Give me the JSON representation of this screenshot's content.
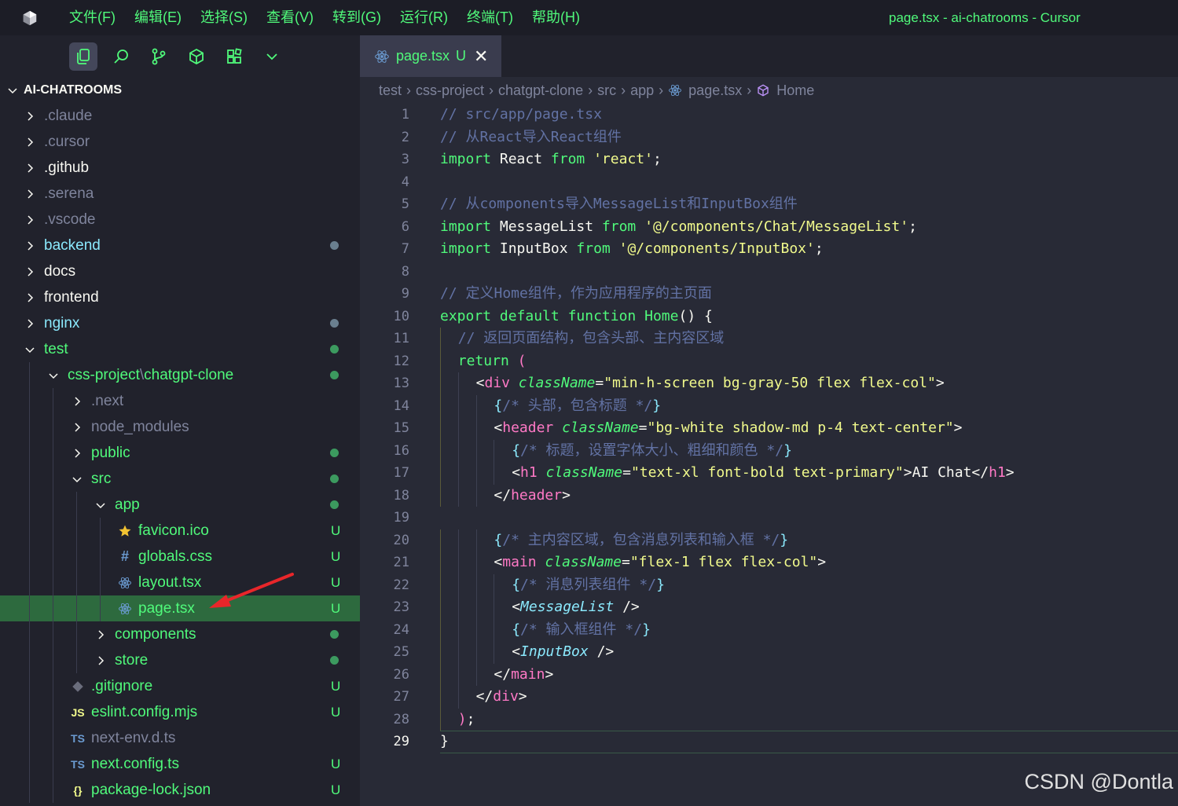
{
  "window": {
    "title": "page.tsx - ai-chatrooms - Cursor"
  },
  "menu": [
    "文件(F)",
    "编辑(E)",
    "选择(S)",
    "查看(V)",
    "转到(G)",
    "运行(R)",
    "终端(T)",
    "帮助(H)"
  ],
  "activity_icons": [
    "explorer-icon",
    "search-icon",
    "source-control-icon",
    "extensions-icon",
    "grid-icon",
    "chevron-down-icon"
  ],
  "tab": {
    "label": "page.tsx",
    "badge": "U",
    "close": "✕"
  },
  "breadcrumb": [
    "test",
    "css-project",
    "chatgpt-clone",
    "src",
    "app",
    "page.tsx",
    "Home"
  ],
  "explorer": {
    "title": "AI-CHATROOMS",
    "items": [
      {
        "label": ".claude",
        "depth": 0,
        "kind": "folder",
        "expanded": false,
        "style": "dim",
        "status": ""
      },
      {
        "label": ".cursor",
        "depth": 0,
        "kind": "folder",
        "expanded": false,
        "style": "dim",
        "status": ""
      },
      {
        "label": ".github",
        "depth": 0,
        "kind": "folder",
        "expanded": false,
        "style": "white",
        "status": ""
      },
      {
        "label": ".serena",
        "depth": 0,
        "kind": "folder",
        "expanded": false,
        "style": "dim",
        "status": ""
      },
      {
        "label": ".vscode",
        "depth": 0,
        "kind": "folder",
        "expanded": false,
        "style": "dim",
        "status": ""
      },
      {
        "label": "backend",
        "depth": 0,
        "kind": "folder",
        "expanded": false,
        "style": "cyan",
        "status": "dot-gray"
      },
      {
        "label": "docs",
        "depth": 0,
        "kind": "folder",
        "expanded": false,
        "style": "white",
        "status": ""
      },
      {
        "label": "frontend",
        "depth": 0,
        "kind": "folder",
        "expanded": false,
        "style": "white",
        "status": ""
      },
      {
        "label": "nginx",
        "depth": 0,
        "kind": "folder",
        "expanded": false,
        "style": "cyan",
        "status": "dot-gray"
      },
      {
        "label": "test",
        "depth": 0,
        "kind": "folder",
        "expanded": true,
        "style": "green",
        "status": "dot-green"
      },
      {
        "label": "css-project",
        "label2": "chatgpt-clone",
        "depth": 1,
        "kind": "folder",
        "expanded": true,
        "style": "green",
        "status": "dot-green"
      },
      {
        "label": ".next",
        "depth": 2,
        "kind": "folder",
        "expanded": false,
        "style": "dim",
        "status": ""
      },
      {
        "label": "node_modules",
        "depth": 2,
        "kind": "folder",
        "expanded": false,
        "style": "dim",
        "status": ""
      },
      {
        "label": "public",
        "depth": 2,
        "kind": "folder",
        "expanded": false,
        "style": "green",
        "status": "dot-green"
      },
      {
        "label": "src",
        "depth": 2,
        "kind": "folder",
        "expanded": true,
        "style": "green",
        "status": "dot-green"
      },
      {
        "label": "app",
        "depth": 3,
        "kind": "folder",
        "expanded": true,
        "style": "green",
        "status": "dot-green"
      },
      {
        "label": "favicon.ico",
        "depth": 4,
        "kind": "file",
        "icon": "star-icon",
        "style": "green",
        "status": "U"
      },
      {
        "label": "globals.css",
        "depth": 4,
        "kind": "file",
        "icon": "hash-icon",
        "style": "green",
        "status": "U"
      },
      {
        "label": "layout.tsx",
        "depth": 4,
        "kind": "file",
        "icon": "react-icon",
        "style": "green",
        "status": "U"
      },
      {
        "label": "page.tsx",
        "depth": 4,
        "kind": "file",
        "icon": "react-icon",
        "style": "green",
        "status": "U",
        "selected": true
      },
      {
        "label": "components",
        "depth": 3,
        "kind": "folder",
        "expanded": false,
        "style": "green",
        "status": "dot-green"
      },
      {
        "label": "store",
        "depth": 3,
        "kind": "folder",
        "expanded": false,
        "style": "green",
        "status": "dot-green"
      },
      {
        "label": ".gitignore",
        "depth": 2,
        "kind": "file",
        "icon": "git-icon",
        "style": "green",
        "status": "U"
      },
      {
        "label": "eslint.config.mjs",
        "depth": 2,
        "kind": "file",
        "icon": "js-icon",
        "icon_text": "JS",
        "style": "green",
        "status": "U"
      },
      {
        "label": "next-env.d.ts",
        "depth": 2,
        "kind": "file",
        "icon": "ts-icon",
        "icon_text": "TS",
        "style": "dim",
        "status": ""
      },
      {
        "label": "next.config.ts",
        "depth": 2,
        "kind": "file",
        "icon": "ts-icon",
        "icon_text": "TS",
        "style": "green",
        "status": "U"
      },
      {
        "label": "package-lock.json",
        "depth": 2,
        "kind": "file",
        "icon": "json-icon",
        "icon_text": "{}",
        "style": "green",
        "status": "U"
      }
    ]
  },
  "editor": {
    "current_line": 29,
    "lines": [
      {
        "n": "1",
        "indent": 0,
        "tokens": [
          [
            "c-com",
            "// src/app/page.tsx"
          ]
        ]
      },
      {
        "n": "2",
        "indent": 0,
        "tokens": [
          [
            "c-com",
            "// 从React导入React组件"
          ]
        ]
      },
      {
        "n": "3",
        "indent": 0,
        "tokens": [
          [
            "c-kw",
            "import"
          ],
          [
            "",
            " React "
          ],
          [
            "c-kw",
            "from"
          ],
          [
            "",
            " "
          ],
          [
            "c-str",
            "'react'"
          ],
          [
            "",
            ";"
          ]
        ]
      },
      {
        "n": "4",
        "indent": 0,
        "tokens": []
      },
      {
        "n": "5",
        "indent": 0,
        "tokens": [
          [
            "c-com",
            "// 从components导入MessageList和InputBox组件"
          ]
        ]
      },
      {
        "n": "6",
        "indent": 0,
        "tokens": [
          [
            "c-kw",
            "import"
          ],
          [
            "",
            " MessageList "
          ],
          [
            "c-kw",
            "from"
          ],
          [
            "",
            " "
          ],
          [
            "c-str",
            "'@/components/Chat/MessageList'"
          ],
          [
            "",
            ";"
          ]
        ]
      },
      {
        "n": "7",
        "indent": 0,
        "tokens": [
          [
            "c-kw",
            "import"
          ],
          [
            "",
            " InputBox "
          ],
          [
            "c-kw",
            "from"
          ],
          [
            "",
            " "
          ],
          [
            "c-str",
            "'@/components/InputBox'"
          ],
          [
            "",
            ";"
          ]
        ]
      },
      {
        "n": "8",
        "indent": 0,
        "tokens": []
      },
      {
        "n": "9",
        "indent": 0,
        "tokens": [
          [
            "c-com",
            "// 定义Home组件，作为应用程序的主页面"
          ]
        ]
      },
      {
        "n": "10",
        "indent": 0,
        "tokens": [
          [
            "c-kw",
            "export"
          ],
          [
            "",
            " "
          ],
          [
            "c-kw",
            "default"
          ],
          [
            "",
            " "
          ],
          [
            "c-kw",
            "function"
          ],
          [
            "",
            " "
          ],
          [
            "c-fn",
            "Home"
          ],
          [
            "",
            "() {"
          ]
        ]
      },
      {
        "n": "11",
        "indent": 1,
        "tokens": [
          [
            "c-com",
            "// 返回页面结构，包含头部、主内容区域"
          ]
        ]
      },
      {
        "n": "12",
        "indent": 1,
        "tokens": [
          [
            "c-kw",
            "return"
          ],
          [
            "",
            " "
          ],
          [
            "c-paren",
            "("
          ]
        ]
      },
      {
        "n": "13",
        "indent": 2,
        "tokens": [
          [
            "",
            "<"
          ],
          [
            "c-tag",
            "div"
          ],
          [
            "",
            " "
          ],
          [
            "c-attr",
            "className"
          ],
          [
            "",
            "="
          ],
          [
            "c-str",
            "\"min-h-screen bg-gray-50 flex flex-col\""
          ],
          [
            "",
            ">"
          ]
        ]
      },
      {
        "n": "14",
        "indent": 3,
        "tokens": [
          [
            "c-brace",
            "{"
          ],
          [
            "c-com",
            "/* 头部，包含标题 */"
          ],
          [
            "c-brace",
            "}"
          ]
        ]
      },
      {
        "n": "15",
        "indent": 3,
        "tokens": [
          [
            "",
            "<"
          ],
          [
            "c-tag",
            "header"
          ],
          [
            "",
            " "
          ],
          [
            "c-attr",
            "className"
          ],
          [
            "",
            "="
          ],
          [
            "c-str",
            "\"bg-white shadow-md p-4 text-center\""
          ],
          [
            "",
            ">"
          ]
        ]
      },
      {
        "n": "16",
        "indent": 4,
        "tokens": [
          [
            "c-brace",
            "{"
          ],
          [
            "c-com",
            "/* 标题，设置字体大小、粗细和颜色 */"
          ],
          [
            "c-brace",
            "}"
          ]
        ]
      },
      {
        "n": "17",
        "indent": 4,
        "tokens": [
          [
            "",
            "<"
          ],
          [
            "c-tag",
            "h1"
          ],
          [
            "",
            " "
          ],
          [
            "c-attr",
            "className"
          ],
          [
            "",
            "="
          ],
          [
            "c-str",
            "\"text-xl font-bold text-primary\""
          ],
          [
            "",
            ">AI Chat</"
          ],
          [
            "c-tag",
            "h1"
          ],
          [
            "",
            ">"
          ]
        ]
      },
      {
        "n": "18",
        "indent": 3,
        "tokens": [
          [
            "",
            "</"
          ],
          [
            "c-tag",
            "header"
          ],
          [
            "",
            ">"
          ]
        ]
      },
      {
        "n": "19",
        "indent": 0,
        "tokens": []
      },
      {
        "n": "20",
        "indent": 3,
        "tokens": [
          [
            "c-brace",
            "{"
          ],
          [
            "c-com",
            "/* 主内容区域，包含消息列表和输入框 */"
          ],
          [
            "c-brace",
            "}"
          ]
        ]
      },
      {
        "n": "21",
        "indent": 3,
        "tokens": [
          [
            "",
            "<"
          ],
          [
            "c-tag",
            "main"
          ],
          [
            "",
            " "
          ],
          [
            "c-attr",
            "className"
          ],
          [
            "",
            "="
          ],
          [
            "c-str",
            "\"flex-1 flex flex-col\""
          ],
          [
            "",
            ">"
          ]
        ]
      },
      {
        "n": "22",
        "indent": 4,
        "tokens": [
          [
            "c-brace",
            "{"
          ],
          [
            "c-com",
            "/* 消息列表组件 */"
          ],
          [
            "c-brace",
            "}"
          ]
        ]
      },
      {
        "n": "23",
        "indent": 4,
        "tokens": [
          [
            "",
            "<"
          ],
          [
            "c-comp",
            "MessageList"
          ],
          [
            "",
            " />"
          ]
        ]
      },
      {
        "n": "24",
        "indent": 4,
        "tokens": [
          [
            "c-brace",
            "{"
          ],
          [
            "c-com",
            "/* 输入框组件 */"
          ],
          [
            "c-brace",
            "}"
          ]
        ]
      },
      {
        "n": "25",
        "indent": 4,
        "tokens": [
          [
            "",
            "<"
          ],
          [
            "c-comp",
            "InputBox"
          ],
          [
            "",
            " />"
          ]
        ]
      },
      {
        "n": "26",
        "indent": 3,
        "tokens": [
          [
            "",
            "</"
          ],
          [
            "c-tag",
            "main"
          ],
          [
            "",
            ">"
          ]
        ]
      },
      {
        "n": "27",
        "indent": 2,
        "tokens": [
          [
            "",
            "</"
          ],
          [
            "c-tag",
            "div"
          ],
          [
            "",
            ">"
          ]
        ]
      },
      {
        "n": "28",
        "indent": 1,
        "tokens": [
          [
            "c-paren",
            ")"
          ],
          [
            "",
            ";"
          ]
        ]
      },
      {
        "n": "29",
        "indent": 0,
        "tokens": [
          [
            "",
            "}"
          ]
        ]
      }
    ]
  },
  "watermark": "CSDN @Dontla",
  "colors": {
    "accent_green": "#50fa7b",
    "selection": "#2d6a3e",
    "editor_bg": "#282a36",
    "sidebar_bg": "#21222c"
  }
}
